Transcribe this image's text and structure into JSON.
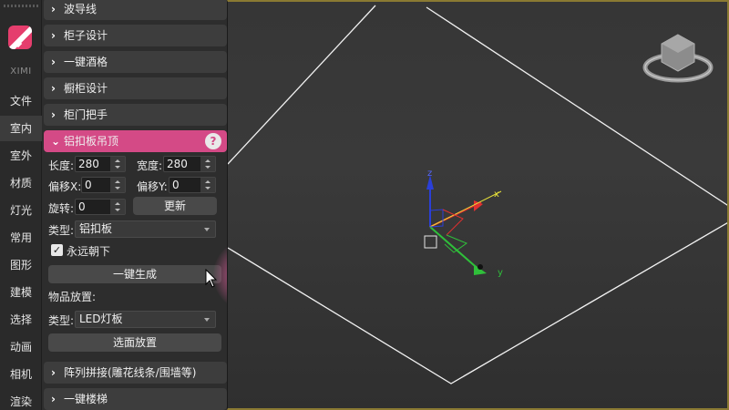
{
  "sidebar": {
    "brand": "XIMI",
    "items": [
      {
        "label": "文件",
        "active": false
      },
      {
        "label": "室内",
        "active": true
      },
      {
        "label": "室外",
        "active": false
      },
      {
        "label": "材质",
        "active": false
      },
      {
        "label": "灯光",
        "active": false
      },
      {
        "label": "常用",
        "active": false
      },
      {
        "label": "图形",
        "active": false
      },
      {
        "label": "建模",
        "active": false
      },
      {
        "label": "选择",
        "active": false
      },
      {
        "label": "动画",
        "active": false
      },
      {
        "label": "相机",
        "active": false
      },
      {
        "label": "渲染",
        "active": false
      }
    ]
  },
  "panel": {
    "sections_top": [
      "波导线",
      "柜子设计",
      "一键酒格",
      "橱柜设计",
      "柜门把手"
    ],
    "open_section": {
      "title": "铝扣板吊顶",
      "help": "?",
      "length_label": "长度:",
      "length_value": "280",
      "width_label": "宽度:",
      "width_value": "280",
      "offset_x_label": "偏移X:",
      "offset_x_value": "0",
      "offset_y_label": "偏移Y:",
      "offset_y_value": "0",
      "rotate_label": "旋转:",
      "rotate_value": "0",
      "update_button": "更新",
      "type_label": "类型:",
      "type_value": "铝扣板",
      "always_down_label": "永远朝下",
      "always_down_checked": true,
      "generate_button": "一键生成",
      "placement_label": "物品放置:",
      "placement_type_label": "类型:",
      "placement_type_value": "LED灯板",
      "select_place_button": "选面放置"
    },
    "sections_bottom": [
      "阵列拼接(雕花线条/围墙等)",
      "一键楼梯"
    ]
  },
  "viewport": {
    "gizmo_axis_z": "z",
    "gizmo_axis_x": "x",
    "gizmo_axis_y": "y",
    "colors": {
      "x": "#e03030",
      "y": "#2fbf3a",
      "z": "#2a3fd8",
      "frame": "#8a7a32"
    }
  }
}
